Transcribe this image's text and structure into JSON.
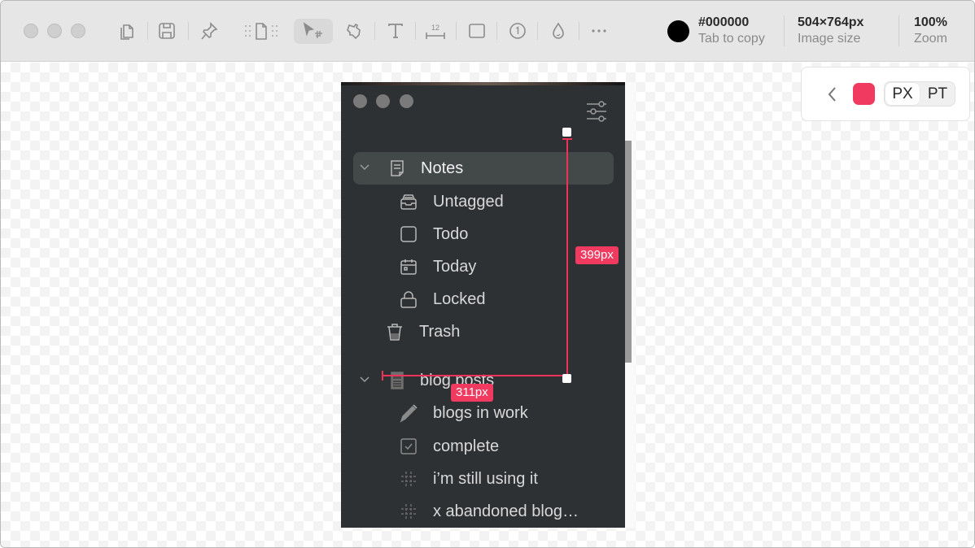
{
  "toolbar": {
    "tools": [
      {
        "name": "copy-icon"
      },
      {
        "name": "save-icon"
      },
      {
        "name": "pin-icon"
      },
      {
        "name": "page-layout-icon"
      },
      {
        "name": "select-crop-icon",
        "active": true
      },
      {
        "name": "hand-pointer-icon"
      },
      {
        "name": "text-icon"
      },
      {
        "name": "ruler-measure-icon",
        "badge": "12"
      },
      {
        "name": "rectangle-icon"
      },
      {
        "name": "counter-icon",
        "badge": "1"
      },
      {
        "name": "blur-drop-icon"
      },
      {
        "name": "more-icon"
      }
    ],
    "color": {
      "hex": "#000000",
      "value": "#000000",
      "label": "Tab to copy"
    },
    "image_size": {
      "value": "504×764px",
      "label": "Image size"
    },
    "zoom": {
      "value": "100%",
      "label": "Zoom"
    }
  },
  "panel": {
    "swatch_color": "#f03a60",
    "units": [
      {
        "label": "PX",
        "selected": true
      },
      {
        "label": "PT",
        "selected": false
      }
    ]
  },
  "measurements": {
    "vertical": "399px",
    "horizontal": "311px"
  },
  "screenshot": {
    "sidebar": {
      "notes": {
        "label": "Notes",
        "expanded": true
      },
      "notes_children": [
        {
          "label": "Untagged",
          "icon": "inbox-icon"
        },
        {
          "label": "Todo",
          "icon": "checkbox-icon"
        },
        {
          "label": "Today",
          "icon": "calendar-icon"
        },
        {
          "label": "Locked",
          "icon": "lock-icon"
        }
      ],
      "trash": {
        "label": "Trash"
      },
      "blog": {
        "label": "blog posts",
        "expanded": true
      },
      "blog_children": [
        {
          "label": "blogs in work",
          "icon": "pencil-icon"
        },
        {
          "label": "complete",
          "icon": "checked-box-icon"
        },
        {
          "label": "i’m still using it",
          "icon": "hashtag-icon"
        },
        {
          "label": "x abandoned blog…",
          "icon": "hashtag-icon"
        }
      ]
    }
  }
}
